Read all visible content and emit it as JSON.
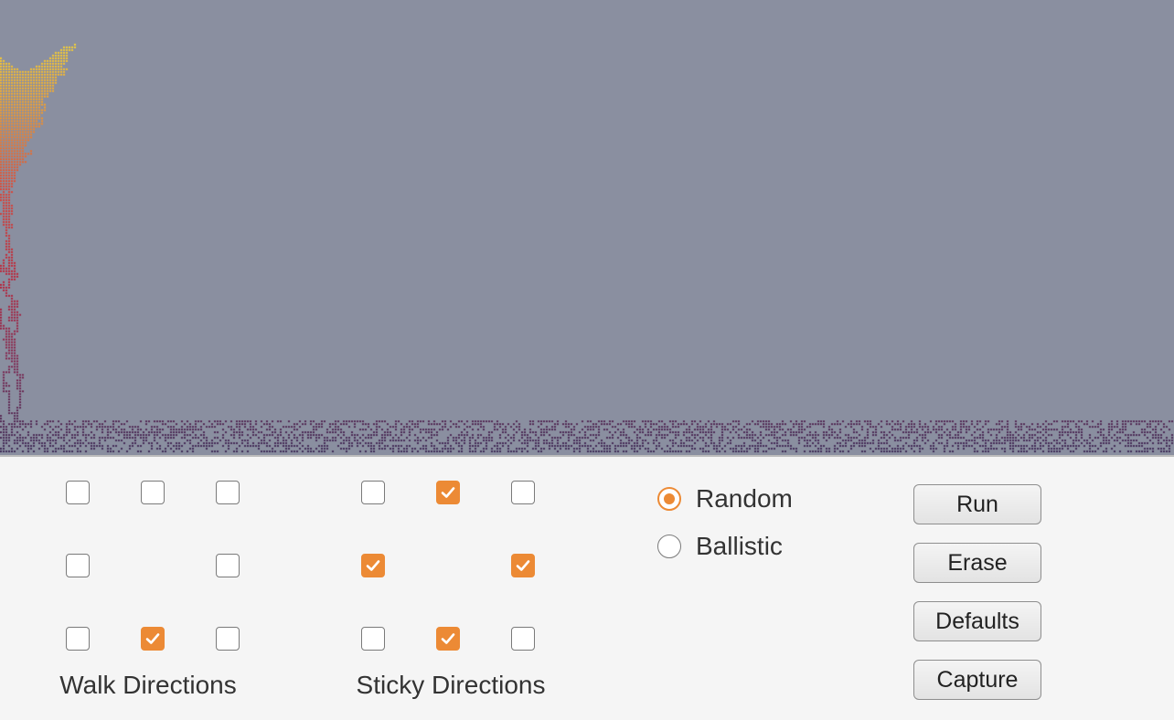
{
  "simulation": {
    "background_color": "#8a8fa0",
    "gradient_colors": [
      "#f5e43a",
      "#f0a030",
      "#d8463a",
      "#b8283e",
      "#7e2c55",
      "#3f2d58"
    ]
  },
  "walk_directions": {
    "label": "Walk Directions",
    "checked": [
      false,
      false,
      false,
      false,
      false,
      false,
      true,
      false
    ]
  },
  "sticky_directions": {
    "label": "Sticky Directions",
    "checked": [
      false,
      true,
      false,
      true,
      true,
      false,
      true,
      false
    ]
  },
  "mode": {
    "options": [
      "Random",
      "Ballistic"
    ],
    "selected": "Random"
  },
  "buttons": {
    "run": "Run",
    "erase": "Erase",
    "defaults": "Defaults",
    "capture": "Capture"
  },
  "accent_color": "#ec8a35"
}
